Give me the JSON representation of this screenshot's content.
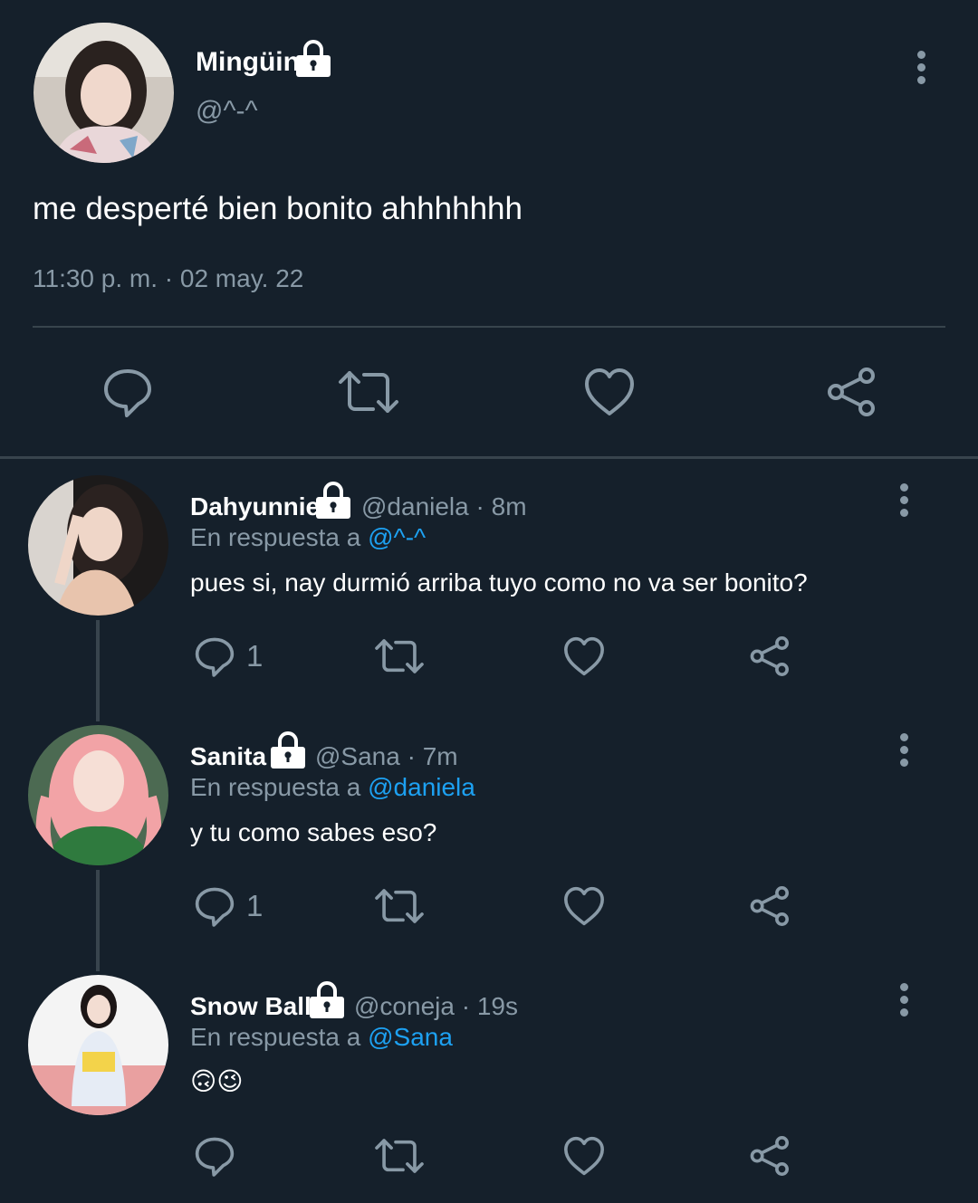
{
  "main_tweet": {
    "display_name": "Mingüin",
    "handle": "@^-^",
    "text": "me desperté bien bonito ahhhhhhh",
    "timestamp": "11:30 p. m. · 02 may. 22",
    "actions": [
      "reply-icon",
      "retweet-icon",
      "like-icon",
      "share-icon"
    ]
  },
  "replies": [
    {
      "display_name": "Dahyunnie",
      "handle": "@daniela",
      "time": "8m",
      "reply_prefix": "En respuesta a",
      "reply_to": "@^-^",
      "text": "pues si, nay durmió arriba tuyo como no va ser bonito?",
      "reply_count": "1"
    },
    {
      "display_name": "Sanita",
      "handle": "@Sana",
      "time": "7m",
      "reply_prefix": "En respuesta a",
      "reply_to": "@daniela",
      "text": "y tu como sabes eso?",
      "reply_count": "1"
    },
    {
      "display_name": "Snow Ball",
      "handle": "@coneja",
      "time": "19s",
      "reply_prefix": "En respuesta a",
      "reply_to": "@Sana",
      "text": "🙃😉",
      "reply_count": ""
    }
  ],
  "separator": "·",
  "colors": {
    "background": "#15202b",
    "text": "#ffffff",
    "muted": "#8899a6",
    "link": "#1da1f2",
    "divider": "#38444d"
  }
}
